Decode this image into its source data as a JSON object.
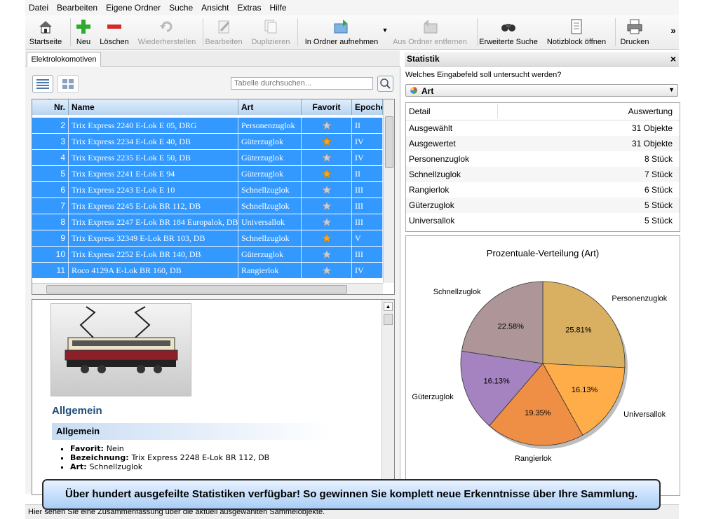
{
  "menu": [
    "Datei",
    "Bearbeiten",
    "Eigene Ordner",
    "Suche",
    "Ansicht",
    "Extras",
    "Hilfe"
  ],
  "toolbar": [
    {
      "label": "Startseite",
      "icon": "home-icon",
      "enabled": true
    },
    {
      "label": "Neu",
      "icon": "plus-icon",
      "enabled": true
    },
    {
      "label": "Löschen",
      "icon": "minus-icon",
      "enabled": true
    },
    {
      "label": "Wiederherstellen",
      "icon": "restore-icon",
      "enabled": false
    },
    {
      "label": "Bearbeiten",
      "icon": "pencil-icon",
      "enabled": false
    },
    {
      "label": "Duplizieren",
      "icon": "duplicate-icon",
      "enabled": false
    },
    {
      "label": "In Ordner aufnehmen",
      "icon": "folder-add-icon",
      "enabled": true
    },
    {
      "label": "Aus Ordner entfernen",
      "icon": "folder-remove-icon",
      "enabled": false
    },
    {
      "label": "Erweiterte Suche",
      "icon": "binoculars-icon",
      "enabled": true
    },
    {
      "label": "Notizblock öffnen",
      "icon": "notepad-icon",
      "enabled": true
    },
    {
      "label": "Drucken",
      "icon": "printer-icon",
      "enabled": true
    }
  ],
  "toolbar_more": "»",
  "tab": {
    "label": "Elektrolokomotiven"
  },
  "search": {
    "placeholder": "Tabelle durchsuchen..."
  },
  "table": {
    "columns": [
      "Nr.",
      "Name",
      "Art",
      "Favorit",
      "Epoche"
    ],
    "rows": [
      {
        "nr": "2",
        "name": "Trix Express 2240 E-Lok E 05, DRG",
        "art": "Personenzuglok",
        "fav": "silver",
        "epoche": "II"
      },
      {
        "nr": "3",
        "name": "Trix Express 2234 E-Lok E 40, DB",
        "art": "Güterzuglok",
        "fav": "gold",
        "epoche": "IV"
      },
      {
        "nr": "4",
        "name": "Trix Express 2235 E-Lok E 50, DB",
        "art": "Güterzuglok",
        "fav": "silver",
        "epoche": "IV"
      },
      {
        "nr": "5",
        "name": "Trix Express 2241 E-Lok E 94",
        "art": "Güterzuglok",
        "fav": "gold",
        "epoche": "II"
      },
      {
        "nr": "6",
        "name": "Trix Express 2243 E-Lok E 10",
        "art": "Schnellzuglok",
        "fav": "silver",
        "epoche": "III"
      },
      {
        "nr": "7",
        "name": "Trix Express 2245 E-Lok BR 112, DB",
        "art": "Schnellzuglok",
        "fav": "silver",
        "epoche": "III"
      },
      {
        "nr": "8",
        "name": "Trix Express 2247 E-Lok BR 184 Europalok, DB",
        "art": "Universallok",
        "fav": "silver",
        "epoche": "III"
      },
      {
        "nr": "9",
        "name": "Trix Express 32349 E-Lok BR 103, DB",
        "art": "Schnellzuglok",
        "fav": "gold",
        "epoche": "V"
      },
      {
        "nr": "10",
        "name": "Trix Express 2252 E-Lok BR 140, DB",
        "art": "Güterzuglok",
        "fav": "silver",
        "epoche": "III"
      },
      {
        "nr": "11",
        "name": "Roco 4129A E-Lok BR 160, DB",
        "art": "Rangierlok",
        "fav": "silver",
        "epoche": "IV"
      }
    ]
  },
  "detail": {
    "section_title": "Allgemein",
    "subsection_title": "Allgemein",
    "fields": [
      {
        "label": "Favorit",
        "value": "Nein"
      },
      {
        "label": "Bezeichnung",
        "value": "Trix Express 2248 E-Lok BR 112, DB"
      },
      {
        "label": "Art",
        "value": "Schnellzuglok"
      }
    ]
  },
  "stats": {
    "title": "Statistik",
    "close": "×",
    "question": "Welches Eingabefeld soll untersucht werden?",
    "selected_field": "Art",
    "columns": [
      "Detail",
      "Auswertung"
    ],
    "rows": [
      {
        "detail": "Ausgewählt",
        "value": "31 Objekte"
      },
      {
        "detail": "Ausgewertet",
        "value": "31 Objekte"
      },
      {
        "detail": "Personenzuglok",
        "value": "8 Stück"
      },
      {
        "detail": "Schnellzuglok",
        "value": "7 Stück"
      },
      {
        "detail": "Rangierlok",
        "value": "6 Stück"
      },
      {
        "detail": "Güterzuglok",
        "value": "5 Stück"
      },
      {
        "detail": "Universallok",
        "value": "5 Stück"
      }
    ]
  },
  "chart_data": {
    "type": "pie",
    "title": "Prozentuale-Verteilung (Art)",
    "slices": [
      {
        "label": "Personenzuglok",
        "value": 25.81,
        "pct_label": "25.81%",
        "color": "#d9b062"
      },
      {
        "label": "Universallok",
        "value": 16.13,
        "pct_label": "16.13%",
        "color": "#ffad48"
      },
      {
        "label": "Rangierlok",
        "value": 19.35,
        "pct_label": "19.35%",
        "color": "#ee8f45"
      },
      {
        "label": "Güterzuglok",
        "value": 16.13,
        "pct_label": "16.13%",
        "color": "#a583c1"
      },
      {
        "label": "Schnellzuglok",
        "value": 22.58,
        "pct_label": "22.58%",
        "color": "#ad9598"
      }
    ]
  },
  "statusbar": "Hier sehen Sie eine Zusammenfassung über die aktuell ausgewählten Sammelobjekte.",
  "banner": "Über hundert ausgefeilte Statistiken verfügbar! So gewinnen Sie komplett neue Erkenntnisse über Ihre Sammlung.",
  "colors": {
    "selection": "#3399ff",
    "accent": "#1f4e79",
    "banner": "#bcd8fa"
  }
}
